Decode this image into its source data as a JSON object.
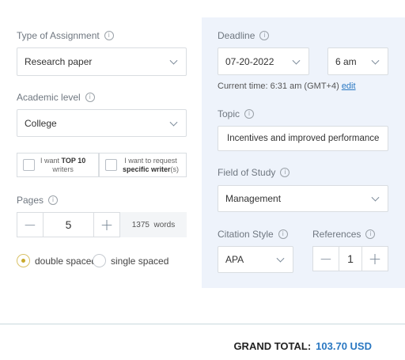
{
  "assignment": {
    "label": "Type of Assignment",
    "value": "Research paper"
  },
  "academic_level": {
    "label": "Academic level",
    "value": "College"
  },
  "writer_options": {
    "top10_pre": "I want ",
    "top10_bold": "TOP 10",
    "top10_post": "writers",
    "specific_pre": "I want to request",
    "specific_bold": "specific writer",
    "specific_post": "(s)"
  },
  "pages": {
    "label": "Pages",
    "value": "5",
    "minus": "−",
    "plus": "+",
    "words": "1375  words"
  },
  "spacing": {
    "option1": "double spaced",
    "option2": "single spaced",
    "selected": "double spaced"
  },
  "deadline": {
    "label": "Deadline",
    "date": "07-20-2022",
    "time": "6 am",
    "current_time": "Current time: 6:31 am (GMT+4)",
    "edit_link": "edit"
  },
  "topic": {
    "label": "Topic",
    "value": "Incentives and improved performance"
  },
  "field_of_study": {
    "label": "Field of Study",
    "value": "Management"
  },
  "citation": {
    "label": "Citation Style",
    "value": "APA"
  },
  "references": {
    "label": "References",
    "value": "1",
    "minus": "−",
    "plus": "+"
  },
  "total": {
    "label": "GRAND TOTAL:",
    "amount": "103.70 USD"
  },
  "icons": {
    "info": "i"
  },
  "colors": {
    "panel_bg": "#eef3fb",
    "accent_blue": "#2a78c2",
    "radio_gold": "#c9a92c"
  }
}
